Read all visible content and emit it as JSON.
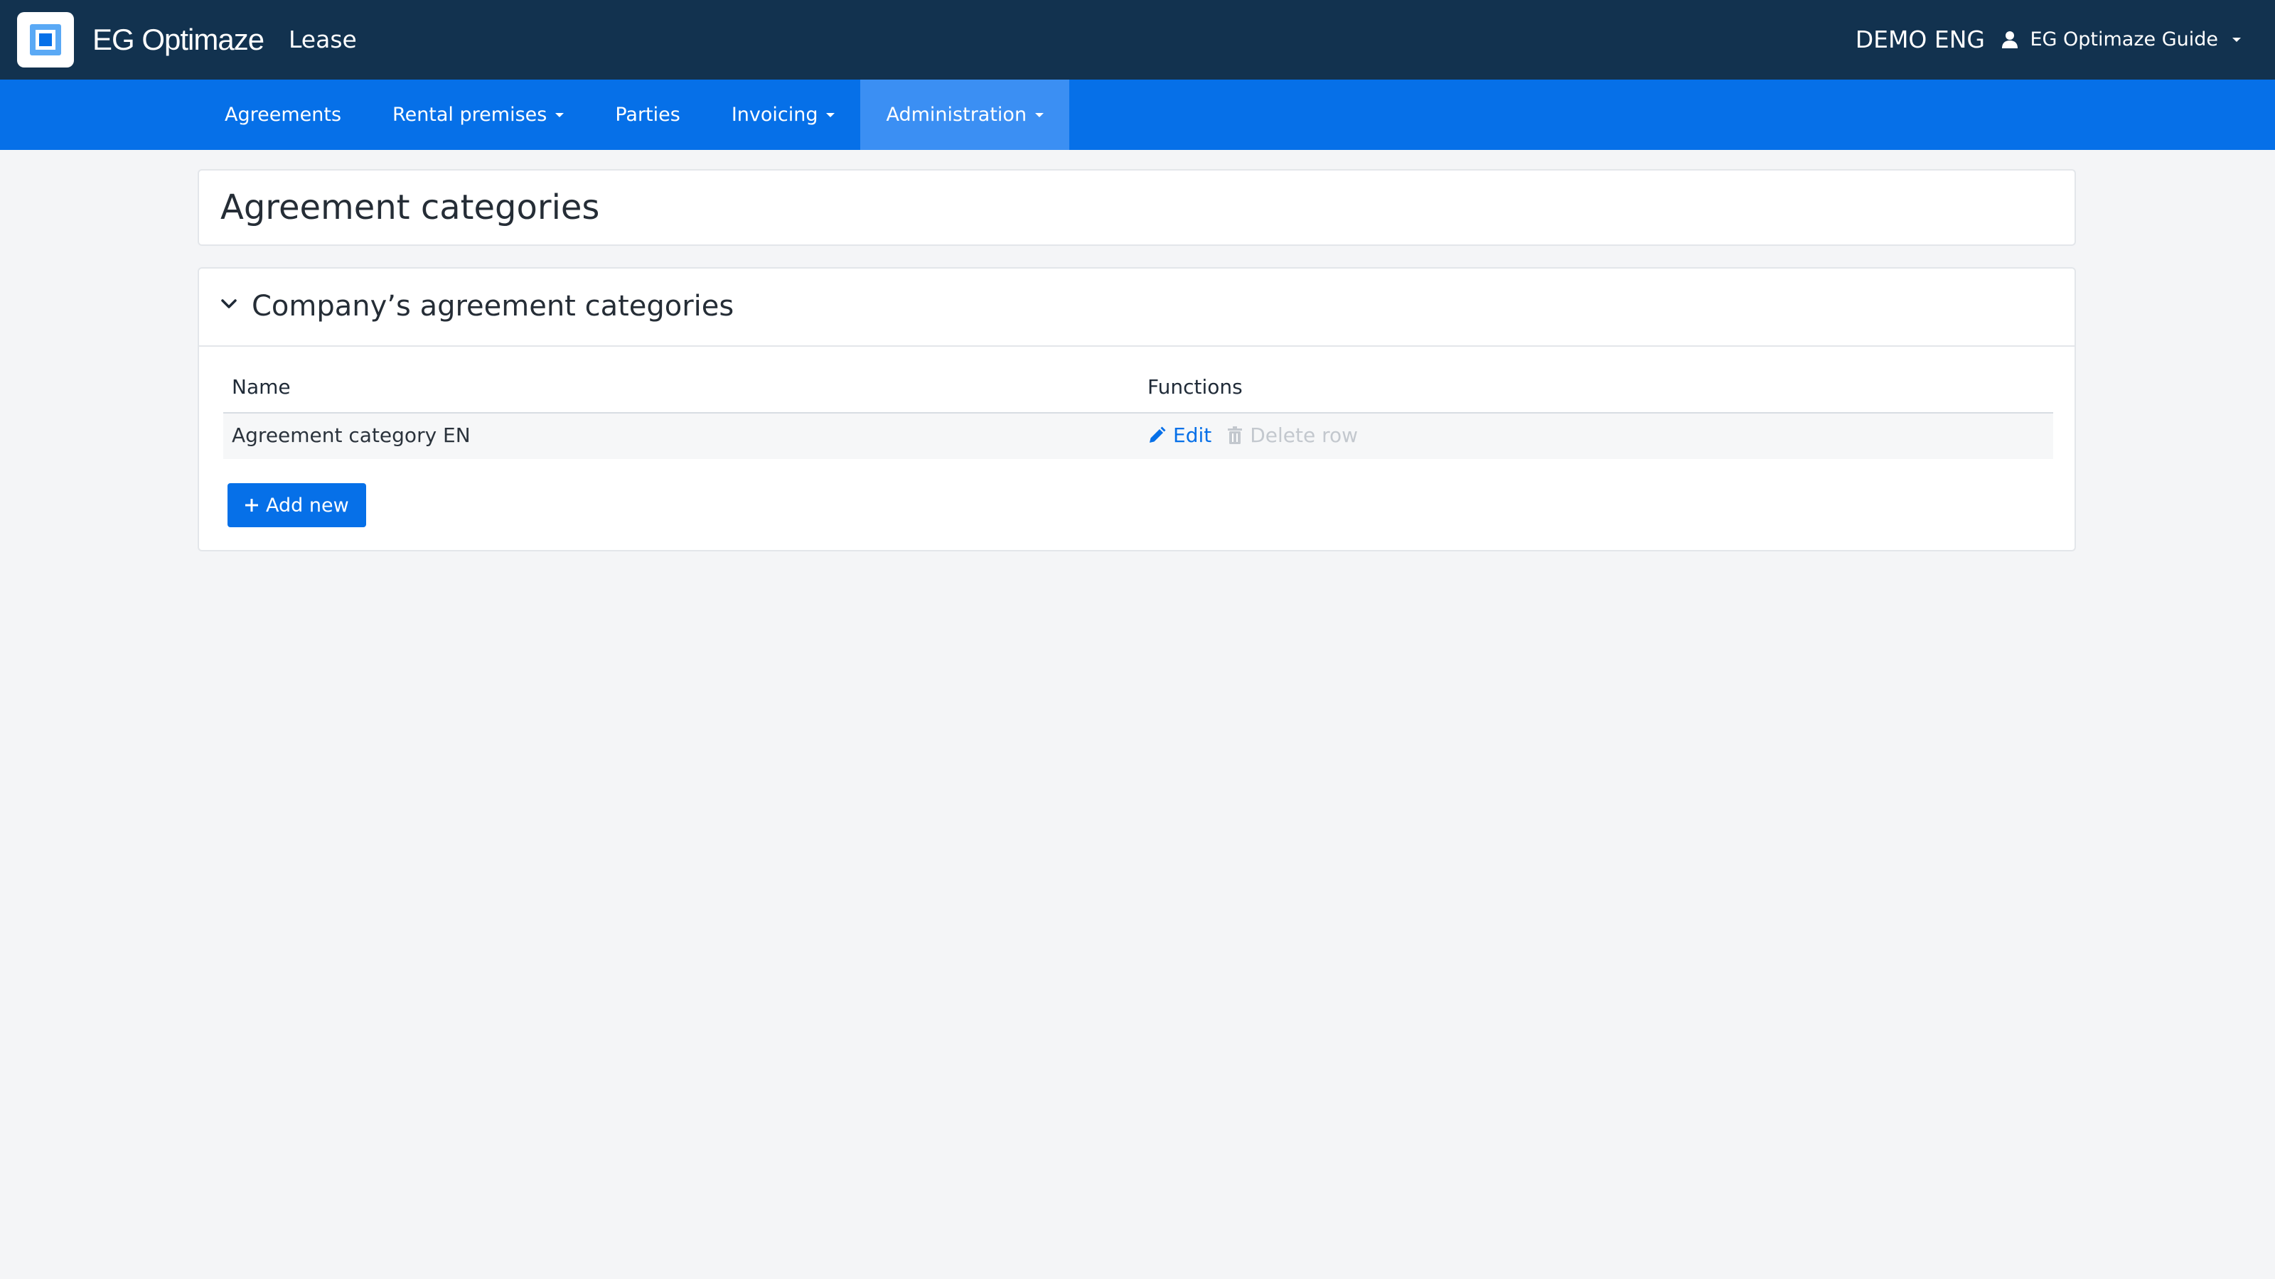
{
  "header": {
    "brand": "EG Optimaze",
    "module": "Lease",
    "company": "DEMO ENG",
    "user": "EG Optimaze Guide"
  },
  "nav": {
    "items": [
      {
        "label": "Agreements",
        "dropdown": false,
        "active": false
      },
      {
        "label": "Rental premises",
        "dropdown": true,
        "active": false
      },
      {
        "label": "Parties",
        "dropdown": false,
        "active": false
      },
      {
        "label": "Invoicing",
        "dropdown": true,
        "active": false
      },
      {
        "label": "Administration",
        "dropdown": true,
        "active": true
      }
    ]
  },
  "page": {
    "title": "Agreement categories"
  },
  "section": {
    "title": "Company’s agreement categories",
    "expanded": true,
    "columns": [
      "Name",
      "Functions"
    ],
    "rows": [
      {
        "name": "Agreement category EN",
        "edit_label": "Edit",
        "delete_label": "Delete row",
        "delete_enabled": false
      }
    ],
    "add_label": "Add new"
  },
  "icons": {
    "logo": "eg-logo-icon",
    "user": "user-icon",
    "toggle": "chevron-down-icon",
    "edit": "pencil-icon",
    "delete": "trash-icon",
    "add": "plus-icon"
  },
  "colors": {
    "header_bg": "#12324f",
    "nav_bg": "#0670e8",
    "nav_active_bg": "#3b8ff3",
    "accent": "#0670e8",
    "disabled_text": "#c3c8ce",
    "page_bg": "#f4f5f7"
  }
}
